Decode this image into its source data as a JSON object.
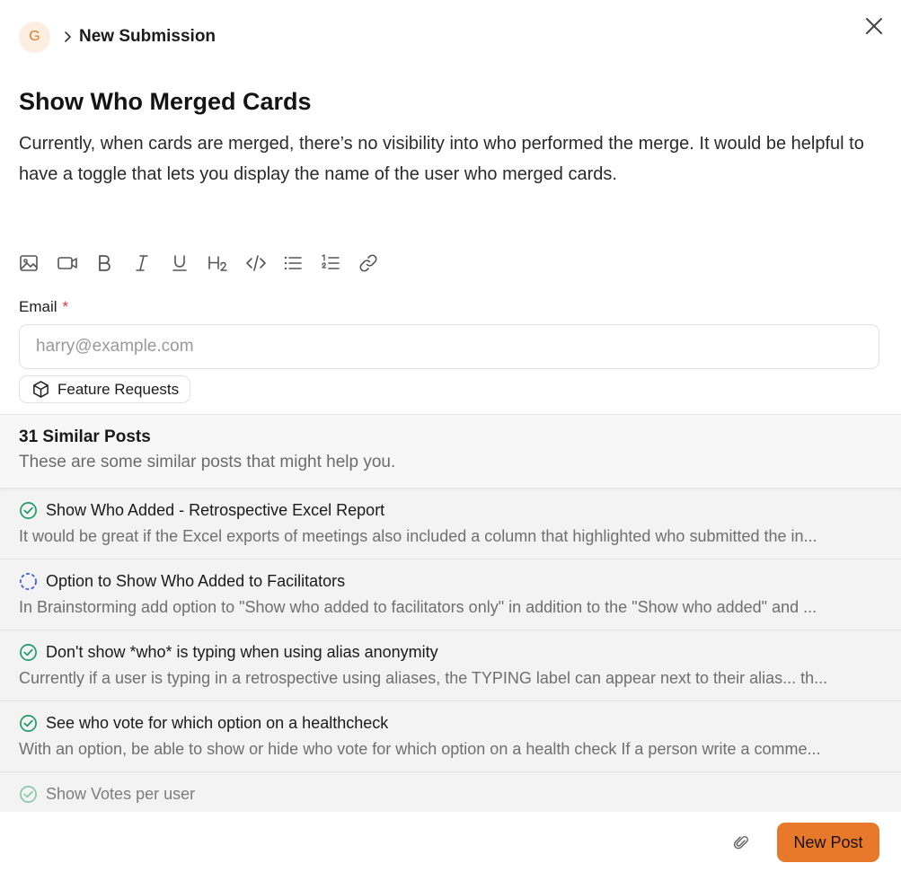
{
  "header": {
    "avatar_letter": "G",
    "breadcrumb": "New Submission"
  },
  "post": {
    "title": "Show Who Merged Cards",
    "description": "Currently, when cards are merged, there’s no visibility into who performed the merge. It would be helpful to have a toggle that lets you display the name of the user who merged cards."
  },
  "toolbar": {
    "items": [
      "image-icon",
      "video-icon",
      "bold-icon",
      "italic-icon",
      "underline-icon",
      "heading2-icon",
      "code-icon",
      "bullet-list-icon",
      "numbered-list-icon",
      "link-icon"
    ]
  },
  "form": {
    "email_label": "Email",
    "required_mark": "*",
    "email_placeholder": "harry@example.com",
    "email_value": "",
    "category": "Feature Requests"
  },
  "similar": {
    "title": "31 Similar Posts",
    "subtitle": "These are some similar posts that might help you.",
    "posts": [
      {
        "status": "complete",
        "title": "Show Who Added - Retrospective Excel Report",
        "body": "It would be great if the Excel exports of meetings also included a column that highlighted who submitted the in..."
      },
      {
        "status": "in-progress",
        "title": "Option to Show Who Added to Facilitators",
        "body": "In Brainstorming add option to \"Show who added to facilitators only\" in addition to the \"Show who added\" and ..."
      },
      {
        "status": "complete",
        "title": "Don't show *who* is typing when using alias anonymity",
        "body": "Currently if a user is typing in a retrospective using aliases, the TYPING label can appear next to their alias... th..."
      },
      {
        "status": "complete",
        "title": "See who vote for which option on a healthcheck",
        "body": "With an option, be able to show or hide who vote for which option on a health check If a person write a comme..."
      },
      {
        "status": "complete",
        "title": "Show Votes per user",
        "body": ""
      }
    ]
  },
  "footer": {
    "submit_label": "New Post"
  },
  "colors": {
    "accent": "#e8782a",
    "complete": "#1f9b6a",
    "in_progress": "#3b5bd9",
    "required": "#d93a3a"
  }
}
